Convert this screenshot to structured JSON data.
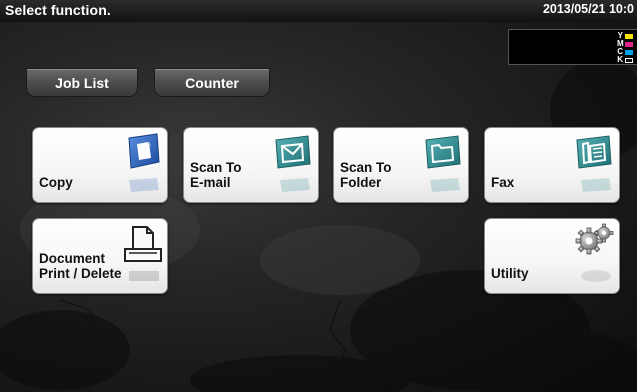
{
  "header": {
    "title": "Select function.",
    "datetime": "2013/05/21 10:0"
  },
  "toner": [
    {
      "label": "Y",
      "color": "#f5e400"
    },
    {
      "label": "M",
      "color": "#e0218a"
    },
    {
      "label": "C",
      "color": "#00a3e8"
    },
    {
      "label": "K",
      "color": "#111111"
    }
  ],
  "tabs": {
    "job_list": "Job List",
    "counter": "Counter"
  },
  "functions": {
    "copy": "Copy",
    "scan_email": "Scan To\nE-mail",
    "scan_folder": "Scan To\nFolder",
    "fax": "Fax",
    "document": "Document\nPrint / Delete",
    "utility": "Utility"
  },
  "icons": {
    "copy": "copy-icon",
    "scan_email": "envelope-icon",
    "scan_folder": "folder-icon",
    "fax": "fax-icon",
    "document": "printer-document-icon",
    "utility": "gears-icon"
  },
  "colors": {
    "copy_icon": "#2a5fb5",
    "scan_icon": "#2f8a8e",
    "fax_icon": "#2f8a8e",
    "gear_icon": "#9a9a9a"
  }
}
